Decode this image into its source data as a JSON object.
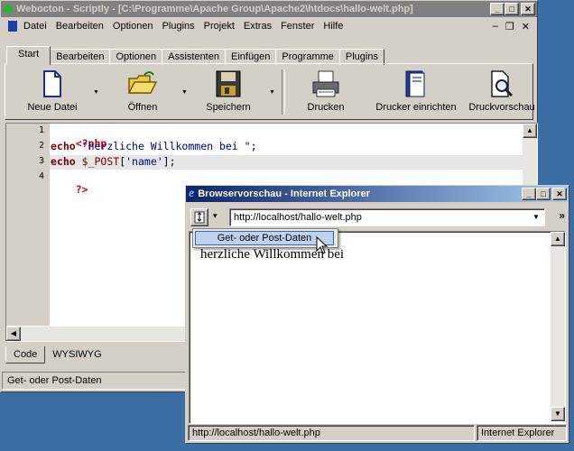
{
  "main_window": {
    "title": "Webocton - Scriptly - [C:\\Programme\\Apache Group\\Apache2\\htdocs\\hallo-welt.php]",
    "controls": {
      "minimize": "_",
      "maximize": "□",
      "close": "✕"
    },
    "menu": [
      "Datei",
      "Bearbeiten",
      "Optionen",
      "Plugins",
      "Projekt",
      "Extras",
      "Fenster",
      "Hilfe"
    ],
    "mdi_controls": {
      "minimize": "–",
      "restore": "❐",
      "close": "✕"
    },
    "ribbon_tabs": [
      "Start",
      "Bearbeiten",
      "Optionen",
      "Assistenten",
      "Einfügen",
      "Programme",
      "Plugins"
    ],
    "selected_tab": "Start",
    "tools": {
      "new_file": "Neue Datei",
      "open": "Öffnen",
      "save": "Speichern",
      "print": "Drucken",
      "printer_setup": "Drucker einrichten",
      "print_preview": "Druckvorschau"
    },
    "editor": {
      "line_numbers": [
        "1",
        "2",
        "3",
        "4"
      ],
      "line1": {
        "open_tag": "<?php"
      },
      "line2": {
        "keyword": "echo",
        "string": "\"herzliche Willkommen bei \"",
        "end": ";"
      },
      "line3": {
        "keyword": "echo",
        "variable": "$_POST",
        "open": "[",
        "string": "'name'",
        "close": "];"
      },
      "line4": {
        "close_tag": "?>"
      }
    },
    "bottom_tabs": [
      "Code",
      "WYSIWYG"
    ],
    "selected_bottom_tab": "Code",
    "status_text": "Get- oder Post-Daten"
  },
  "ie_window": {
    "title": "Browservorschau - Internet Explorer",
    "controls": {
      "minimize": "_",
      "maximize": "□",
      "close": "✕"
    },
    "address": "http://localhost/hallo-welt.php",
    "chevron": "»",
    "dropdown_arrow": "▾",
    "content_text": "herzliche Willkommen bei",
    "status_url": "http://localhost/hallo-welt.php",
    "status_zone": "Internet Explorer",
    "popup_item": "Get- oder Post-Daten"
  },
  "colors": {
    "desktop": "#3a6ea5",
    "title_active": "#0a246a",
    "title_inactive": "#808080",
    "php_tag": "#d00000",
    "keyword": "#7a0000",
    "string": "#000080"
  }
}
